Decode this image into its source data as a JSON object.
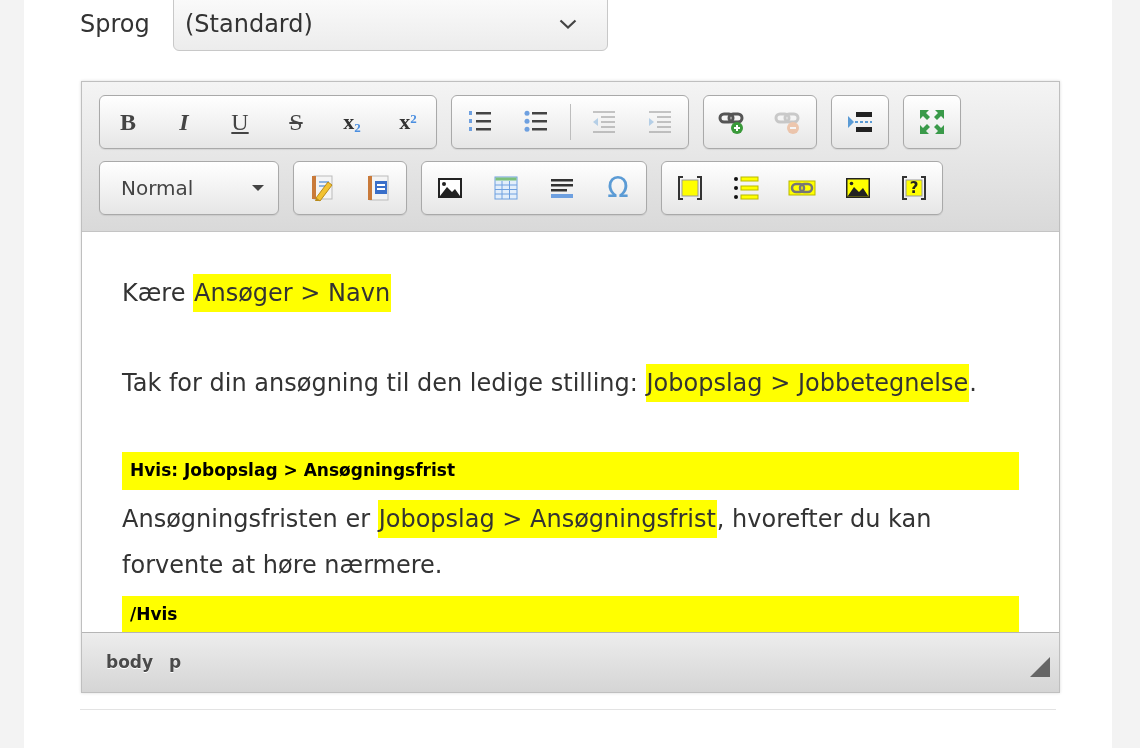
{
  "language": {
    "label": "Sprog",
    "value": "(Standard)"
  },
  "editor": {
    "toolbar": [
      {
        "groups": [
          {
            "kind": "buttons",
            "sections": [
              {
                "buttons": [
                  {
                    "kind": "bold",
                    "label": "B",
                    "disabled": false
                  },
                  {
                    "kind": "italic",
                    "label": "I",
                    "disabled": false
                  },
                  {
                    "kind": "underline",
                    "label": "U",
                    "disabled": false
                  },
                  {
                    "kind": "strike",
                    "label": "S",
                    "disabled": false
                  },
                  {
                    "kind": "subscript",
                    "label": "x$_{2}$",
                    "disabled": false
                  },
                  {
                    "kind": "superscript",
                    "label": "x$^{2}$",
                    "disabled": false
                  }
                ]
              }
            ]
          },
          {
            "kind": "buttons",
            "sections": [
              {
                "buttons": [
                  {
                    "kind": "numbered_list",
                    "disabled": false
                  },
                  {
                    "kind": "bulleted_list",
                    "disabled": false
                  }
                ]
              },
              {
                "buttons": [
                  {
                    "kind": "outdent",
                    "disabled": true
                  },
                  {
                    "kind": "indent",
                    "disabled": true
                  }
                ]
              }
            ]
          },
          {
            "kind": "buttons",
            "sections": [
              {
                "buttons": [
                  {
                    "kind": "link",
                    "disabled": false
                  },
                  {
                    "kind": "unlink",
                    "disabled": true
                  }
                ]
              }
            ]
          },
          {
            "kind": "buttons",
            "sections": [
              {
                "buttons": [
                  {
                    "kind": "block_insert",
                    "disabled": false
                  }
                ]
              }
            ]
          },
          {
            "kind": "buttons",
            "sections": [
              {
                "buttons": [
                  {
                    "kind": "maximize",
                    "disabled": false
                  }
                ]
              }
            ]
          }
        ]
      },
      {
        "groups": [
          {
            "kind": "dropdown",
            "value": "Normal"
          },
          {
            "kind": "buttons",
            "sections": [
              {
                "buttons": [
                  {
                    "kind": "paste_text",
                    "disabled": false
                  },
                  {
                    "kind": "paste_word",
                    "disabled": false
                  }
                ]
              }
            ]
          },
          {
            "kind": "buttons",
            "sections": [
              {
                "buttons": [
                  {
                    "kind": "image",
                    "disabled": false
                  },
                  {
                    "kind": "table",
                    "disabled": false
                  },
                  {
                    "kind": "rule",
                    "disabled": false
                  },
                  {
                    "kind": "special_char",
                    "label": "Ω",
                    "disabled": false
                  }
                ]
              }
            ]
          },
          {
            "kind": "buttons",
            "sections": [
              {
                "buttons": [
                  {
                    "kind": "field_block",
                    "disabled": false
                  },
                  {
                    "kind": "field_list",
                    "disabled": false
                  },
                  {
                    "kind": "field_link",
                    "disabled": false
                  },
                  {
                    "kind": "field_image",
                    "disabled": false
                  },
                  {
                    "kind": "field_condition",
                    "label": "?",
                    "disabled": false
                  }
                ]
              }
            ]
          }
        ]
      }
    ],
    "content": [
      {
        "kind": "paragraph",
        "parts": [
          {
            "kind": "text",
            "text": "Kære "
          },
          {
            "kind": "field",
            "text": "Ansøger > Navn"
          }
        ]
      },
      {
        "kind": "paragraph",
        "parts": [
          {
            "kind": "text",
            "text": "Tak for din ansøgning til den ledige stilling: "
          },
          {
            "kind": "field",
            "text": "Jobopslag > Jobbetegnelse"
          },
          {
            "kind": "text",
            "text": "."
          }
        ]
      },
      {
        "kind": "condition_start",
        "text": "Hvis: Jobopslag > Ansøgningsfrist"
      },
      {
        "kind": "paragraph",
        "parts": [
          {
            "kind": "text",
            "text": "Ansøgningsfristen er "
          },
          {
            "kind": "field",
            "text": "Jobopslag > Ansøgningsfrist"
          },
          {
            "kind": "text",
            "text": ", hvorefter du kan forvente at høre nærmere."
          }
        ]
      },
      {
        "kind": "condition_end",
        "text": "/Hvis"
      }
    ],
    "element_path": [
      "body",
      "p"
    ]
  }
}
